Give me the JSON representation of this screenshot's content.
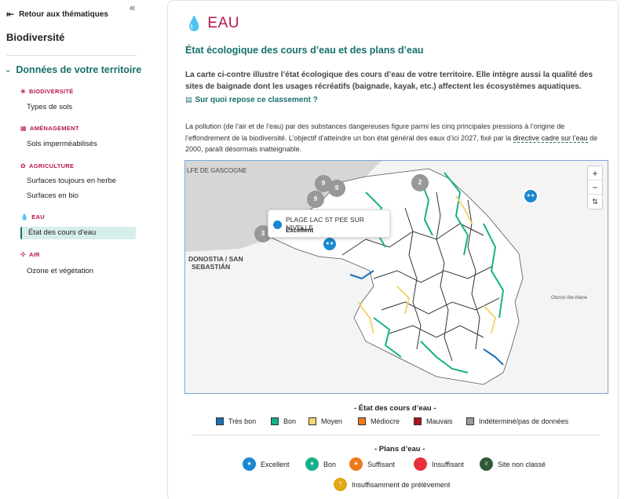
{
  "sidebar": {
    "back_label": "Retour aux thématiques",
    "title": "Biodiversité",
    "section_label": "Données de votre territoire",
    "categories": [
      {
        "label": "BIODIVERSITÉ",
        "items": [
          "Types de sols"
        ]
      },
      {
        "label": "AMÉNAGEMENT",
        "items": [
          "Sols imperméabilisés"
        ]
      },
      {
        "label": "AGRICULTURE",
        "items": [
          "Surfaces toujours en herbe",
          "Surfaces en bio"
        ]
      },
      {
        "label": "EAU",
        "items": [
          "État des cours d'eau"
        ]
      },
      {
        "label": "AIR",
        "items": [
          "Ozone et végétation"
        ]
      }
    ],
    "active_item": "État des cours d'eau"
  },
  "main": {
    "title": "EAU",
    "heading": "État écologique des cours d’eau et des plans d’eau",
    "intro": "La carte ci-contre illustre l’état écologique des cours d’eau de votre territoire. Elle intègre aussi la qualité des sites de baignade dont les usages récréatifs (baignade, kayak, etc.) affectent les écosystèmes aquatiques.",
    "basis_link": "Sur quoi repose ce classement ?",
    "para_before": "La pollution (de l’air et de l’eau) par des substances dangereuses figure parmi les cinq principales pressions à l’origine de l’effondrement de la biodiversité. L’objectif d’atteindre un bon état général des eaux d’ici 2027, fixé par la ",
    "para_link": "directive cadre sur l’eau",
    "para_after": " de 2000, paraît désormais inatteignable."
  },
  "map": {
    "labels": {
      "gulf": "LFE DE GASCOGNE",
      "city_line1": "DONOSTIA / SAN",
      "city_line2": "SEBASTIÁN",
      "oloron": "Oloron-Ste-Marie"
    },
    "clusters": [
      "9",
      "9",
      "9",
      "2",
      "3"
    ],
    "zoom_in": "+",
    "zoom_out": "−",
    "reset": "⇅",
    "tooltip": {
      "name": "PLAGE LAC ST PEE SUR NIVELLE",
      "status": "Excellent"
    }
  },
  "legend": {
    "rivers_title": "- État des cours d’eau -",
    "rivers": [
      {
        "label": "Très bon",
        "color": "#1b6fb8"
      },
      {
        "label": "Bon",
        "color": "#16b08a"
      },
      {
        "label": "Moyen",
        "color": "#f7d472"
      },
      {
        "label": "Médiocre",
        "color": "#ec7a1c"
      },
      {
        "label": "Mauvais",
        "color": "#b0141a"
      },
      {
        "label": "Indéterminé/pas de données",
        "color": "#9a9a9a"
      }
    ],
    "lakes_title": "- Plans d’eau -",
    "lakes": [
      {
        "label": "Excellent",
        "color": "#1b87d0",
        "glyph": "★"
      },
      {
        "label": "Bon",
        "color": "#16b08a",
        "glyph": "★"
      },
      {
        "label": "Suffisant",
        "color": "#ec7a1c",
        "glyph": "★"
      },
      {
        "label": "Insuffisant",
        "color": "#e8303a",
        "glyph": ""
      },
      {
        "label": "Site non classé",
        "color": "#2f5b3a",
        "glyph": "◊"
      },
      {
        "label": "Insuffisamment de prélèvement",
        "color": "#e2a713",
        "glyph": "?"
      }
    ]
  }
}
